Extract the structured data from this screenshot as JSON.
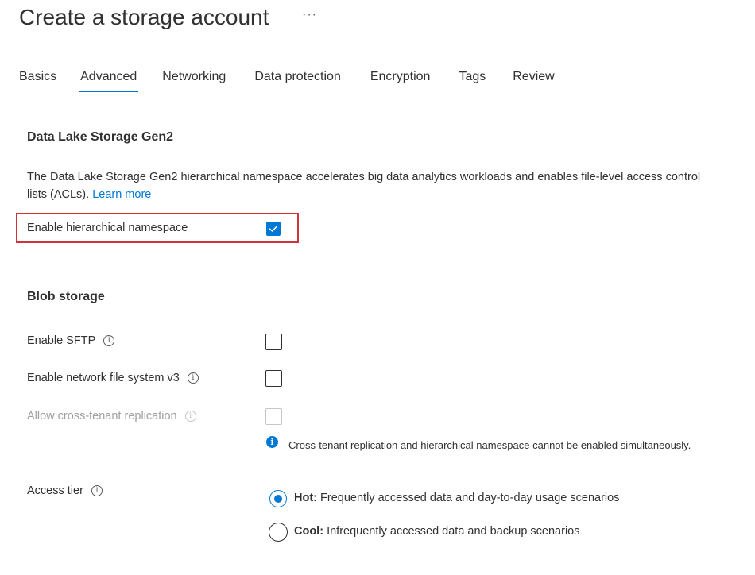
{
  "header": {
    "title": "Create a storage account",
    "more": "···"
  },
  "tabs": [
    {
      "label": "Basics",
      "active": false
    },
    {
      "label": "Advanced",
      "active": true
    },
    {
      "label": "Networking",
      "active": false
    },
    {
      "label": "Data protection",
      "active": false
    },
    {
      "label": "Encryption",
      "active": false
    },
    {
      "label": "Tags",
      "active": false
    },
    {
      "label": "Review",
      "active": false
    }
  ],
  "datalake": {
    "heading": "Data Lake Storage Gen2",
    "description": "The Data Lake Storage Gen2 hierarchical namespace accelerates big data analytics workloads and enables file-level access control lists (ACLs).",
    "learn_more": "Learn more",
    "hns_label": "Enable hierarchical namespace",
    "hns_checked": true
  },
  "blob": {
    "heading": "Blob storage",
    "sftp_label": "Enable SFTP",
    "sftp_checked": false,
    "nfs_label": "Enable network file system v3",
    "nfs_checked": false,
    "cross_tenant_label": "Allow cross-tenant replication",
    "cross_tenant_checked": false,
    "cross_tenant_disabled": true,
    "cross_tenant_note": "Cross-tenant replication and hierarchical namespace cannot be enabled simultaneously.",
    "access_tier_label": "Access tier",
    "tiers": [
      {
        "name": "Hot:",
        "desc": "Frequently accessed data and day-to-day usage scenarios",
        "selected": true
      },
      {
        "name": "Cool:",
        "desc": "Infrequently accessed data and backup scenarios",
        "selected": false
      }
    ]
  },
  "colors": {
    "accent": "#0078d4",
    "highlight": "#d13438",
    "disabled": "#a19f9d"
  }
}
